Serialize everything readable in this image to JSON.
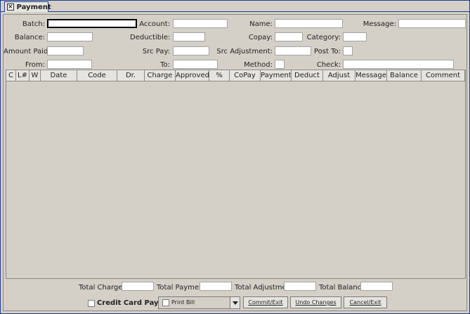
{
  "tab": {
    "label": "Payment"
  },
  "form": {
    "batch_label": "Batch:",
    "account_label": "Account:",
    "name_label": "Name:",
    "message_label": "Message:",
    "balance_label": "Balance:",
    "deductible_label": "Deductible:",
    "copay_label": "Copay:",
    "category_label": "Category:",
    "amount_paid_label": "Amount Paid:",
    "src_pay_label": "Src Pay:",
    "src_adjustment_label": "Src Adjustment:",
    "post_to_label": "Post To:",
    "from_label": "From:",
    "to_label": "To:",
    "method_label": "Method:",
    "check_label": "Check:"
  },
  "grid": {
    "columns": [
      "C",
      "L#",
      "W",
      "Date",
      "Code",
      "Dr.",
      "Charge",
      "Approved",
      "%",
      "CoPay",
      "Payment",
      "Deduct",
      "Adjust",
      "Message",
      "Balance",
      "Comment"
    ]
  },
  "footer": {
    "total_charges_label": "Total Charges:",
    "total_payment_label": "Total Payment:",
    "total_adjustment_label": "Total Adjustment:",
    "total_balance_label": "Total Balance:",
    "credit_card_label": "Credit Card Payment",
    "print_bill_label": "Print Bill",
    "commit_label": "Commit/Exit",
    "undo_label": "Undo Changes",
    "cancel_label": "Cancel/Exit"
  }
}
